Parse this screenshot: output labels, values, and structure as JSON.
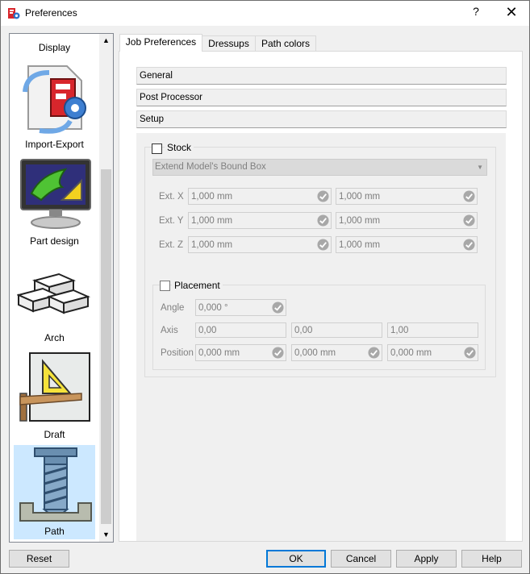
{
  "window": {
    "title": "Preferences",
    "help_glyph": "?",
    "close_glyph": "✕"
  },
  "pages": [
    {
      "label": "Display",
      "icon": "display-icon"
    },
    {
      "label": "Import-Export",
      "icon": "import-export-icon"
    },
    {
      "label": "Part design",
      "icon": "part-design-icon"
    },
    {
      "label": "Arch",
      "icon": "arch-icon"
    },
    {
      "label": "Draft",
      "icon": "draft-icon"
    },
    {
      "label": "Path",
      "icon": "path-icon",
      "selected": true
    }
  ],
  "tabs": [
    {
      "label": "Job Preferences",
      "active": true
    },
    {
      "label": "Dressups"
    },
    {
      "label": "Path colors"
    }
  ],
  "sections": {
    "general": "General",
    "post_processor": "Post Processor",
    "setup": "Setup"
  },
  "stock": {
    "checkbox_label": "Stock",
    "mode": "Extend Model's Bound Box",
    "rows": [
      {
        "label": "Ext. X",
        "neg": "1,000 mm",
        "pos": "1,000 mm"
      },
      {
        "label": "Ext. Y",
        "neg": "1,000 mm",
        "pos": "1,000 mm"
      },
      {
        "label": "Ext. Z",
        "neg": "1,000 mm",
        "pos": "1,000 mm"
      }
    ]
  },
  "placement": {
    "checkbox_label": "Placement",
    "angle_label": "Angle",
    "angle": "0,000 °",
    "axis_label": "Axis",
    "axis": [
      "0,00",
      "0,00",
      "1,00"
    ],
    "position_label": "Position",
    "position": [
      "0,000 mm",
      "0,000 mm",
      "0,000 mm"
    ]
  },
  "buttons": {
    "reset": "Reset",
    "ok": "OK",
    "cancel": "Cancel",
    "apply": "Apply",
    "help": "Help"
  },
  "colors": {
    "selection": "#cce8ff",
    "accent": "#0078d7"
  }
}
